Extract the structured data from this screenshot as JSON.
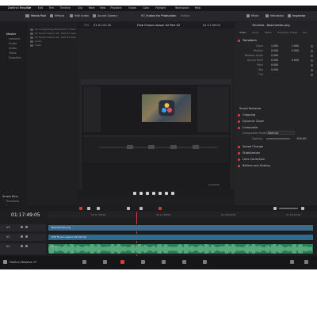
{
  "menubar": {
    "app": "DaVinci Resolve",
    "items": [
      "File",
      "Edit",
      "Trim",
      "Timeline",
      "Clip",
      "Mark",
      "View",
      "Playback",
      "Fusion",
      "Color",
      "Fairlight",
      "Workspace",
      "Help"
    ]
  },
  "toolbar": {
    "left": [
      "Media Pool",
      "Effects",
      "Edit Index",
      "Sound Library"
    ],
    "project_title": "V7_Fusion for Production",
    "edited": "Edited",
    "right": [
      "Mixer",
      "Metadata",
      "Inspector"
    ]
  },
  "viewer": {
    "fps": "FPS",
    "source_timecode": "01:01:41:18",
    "timeline_name": "Final Fusion Lesson 02 Part 02",
    "timeline_timecode": "01:17:49:05"
  },
  "media_pool": {
    "tree": [
      "Master",
      "Lessons",
      "Audio",
      "Video",
      "Titles",
      "Graphics"
    ],
    "clips": [
      "02 Compositing Elements in Fusion Part 01.mov",
      "02 Fusion Lesson 02 - Part 01.mp4",
      "02 Fusion Lesson 02 - Part 02.mp4",
      "Audio",
      "Video"
    ],
    "smart_bins_title": "Smart Bins",
    "smart_bins": [
      "Timelines",
      "Keywords",
      "People"
    ]
  },
  "inspector": {
    "title": "Timeline - Baschlende.png",
    "tabs": [
      "Video",
      "Audio",
      "Effect",
      "Transition",
      "Image",
      "File"
    ],
    "transform_label": "Transform",
    "transform": [
      {
        "label": "Zoom",
        "x": "1.000",
        "y": "1.000"
      },
      {
        "label": "Position",
        "x": "0.000",
        "y": "0.000"
      },
      {
        "label": "Rotation Angle",
        "x": "0.000",
        "y": ""
      },
      {
        "label": "Anchor Point",
        "x": "0.000",
        "y": "0.000"
      },
      {
        "label": "Pitch",
        "x": "0.000",
        "y": ""
      },
      {
        "label": "Yaw",
        "x": "0.000",
        "y": ""
      },
      {
        "label": "Flip",
        "x": "",
        "y": ""
      }
    ],
    "smart_reframe": "Smart Reframe",
    "sections_a": [
      "Cropping",
      "Dynamic Zoom",
      "Composite"
    ],
    "composite_mode_label": "Composite Mode",
    "composite_mode_value": "Normal",
    "opacity_label": "Opacity",
    "opacity_value": "100.00",
    "sections_b": [
      "Speed Change",
      "Stabilization",
      "Lens Correction",
      "Retime and Scaling"
    ]
  },
  "timeline": {
    "timecode": "01:17:49:05",
    "ruler": [
      "01:17:36:00",
      "01:17:48:00",
      "01:18:00:00",
      "01:18:12:00"
    ],
    "tracks": [
      {
        "id": "V2",
        "clip": "Baschlende.png",
        "color": "#3d6b8c"
      },
      {
        "id": "V1",
        "clip": "Edit Fusion Lesson 02 Part 02",
        "color": "#2f6b8f"
      },
      {
        "id": "A1",
        "clip": "Audio 1",
        "color": "#2e7a56",
        "level": "2.0"
      }
    ]
  },
  "statusbar": {
    "app": "DaVinci Resolve 17"
  },
  "watermark": "presenter"
}
